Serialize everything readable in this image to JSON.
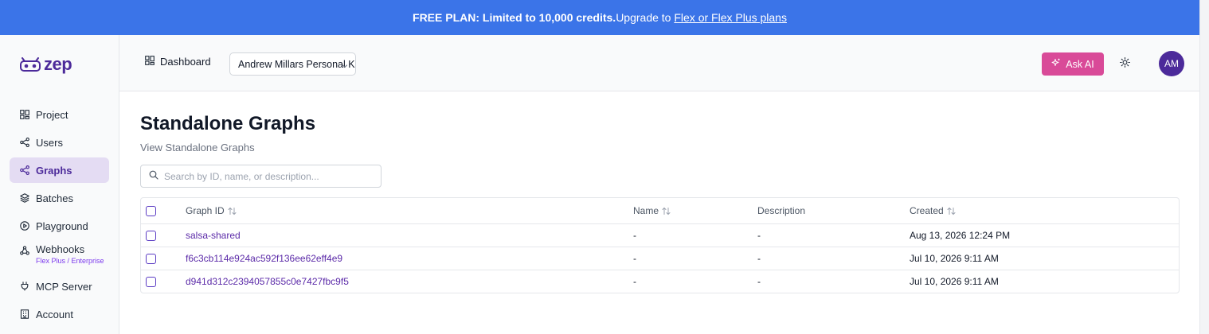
{
  "banner": {
    "bold_text": "FREE PLAN: Limited to 10,000 credits.",
    "text": "Upgrade to ",
    "link": "Flex or Flex Plus plans"
  },
  "logo": {
    "text": "zep"
  },
  "sidebar": {
    "items": [
      {
        "label": "Project",
        "icon": "grid-icon"
      },
      {
        "label": "Users",
        "icon": "share-icon"
      },
      {
        "label": "Graphs",
        "icon": "share-icon",
        "active": true
      },
      {
        "label": "Batches",
        "icon": "layers-icon"
      },
      {
        "label": "Playground",
        "icon": "play-circle-icon"
      },
      {
        "label": "Webhooks",
        "icon": "webhook-icon",
        "sublabel": "Flex Plus / Enterprise"
      },
      {
        "label": "MCP Server",
        "icon": "plug-icon"
      },
      {
        "label": "Account",
        "icon": "building-icon"
      }
    ]
  },
  "topbar": {
    "dashboard_label": "Dashboard",
    "project_select": "Andrew Millars Personal K",
    "ask_ai_label": "Ask AI",
    "avatar_initials": "AM"
  },
  "page": {
    "title": "Standalone Graphs",
    "subtitle": "View Standalone Graphs",
    "search_placeholder": "Search by ID, name, or description..."
  },
  "table": {
    "columns": [
      "Graph ID",
      "Name",
      "Description",
      "Created"
    ],
    "rows": [
      {
        "id": "salsa-shared",
        "name": "-",
        "description": "-",
        "created": "Aug 13, 2026 12:24 PM"
      },
      {
        "id": "f6c3cb114e924ac592f136ee62eff4e9",
        "name": "-",
        "description": "-",
        "created": "Jul 10, 2026 9:11 AM"
      },
      {
        "id": "d941d312c2394057855c0e7427fbc9f5",
        "name": "-",
        "description": "-",
        "created": "Jul 10, 2026 9:11 AM"
      }
    ]
  },
  "colors": {
    "banner": "#3b74e8",
    "brand": "#4c2a9a",
    "ask_ai": "#d94a98",
    "active_nav_bg": "#e4dcf3"
  }
}
